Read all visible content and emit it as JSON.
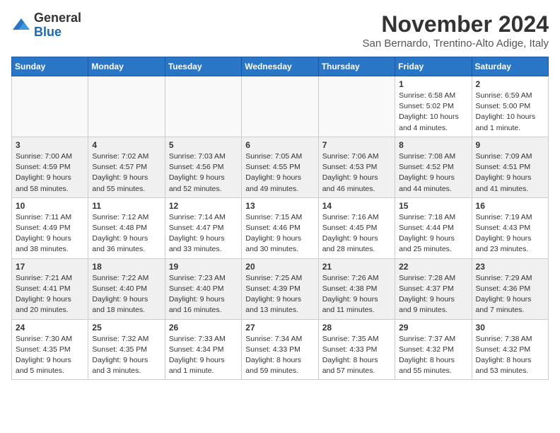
{
  "logo": {
    "general": "General",
    "blue": "Blue"
  },
  "title": "November 2024",
  "location": "San Bernardo, Trentino-Alto Adige, Italy",
  "days_of_week": [
    "Sunday",
    "Monday",
    "Tuesday",
    "Wednesday",
    "Thursday",
    "Friday",
    "Saturday"
  ],
  "weeks": [
    [
      {
        "day": "",
        "info": "",
        "empty": true
      },
      {
        "day": "",
        "info": "",
        "empty": true
      },
      {
        "day": "",
        "info": "",
        "empty": true
      },
      {
        "day": "",
        "info": "",
        "empty": true
      },
      {
        "day": "",
        "info": "",
        "empty": true
      },
      {
        "day": "1",
        "info": "Sunrise: 6:58 AM\nSunset: 5:02 PM\nDaylight: 10 hours\nand 4 minutes."
      },
      {
        "day": "2",
        "info": "Sunrise: 6:59 AM\nSunset: 5:00 PM\nDaylight: 10 hours\nand 1 minute."
      }
    ],
    [
      {
        "day": "3",
        "info": "Sunrise: 7:00 AM\nSunset: 4:59 PM\nDaylight: 9 hours\nand 58 minutes."
      },
      {
        "day": "4",
        "info": "Sunrise: 7:02 AM\nSunset: 4:57 PM\nDaylight: 9 hours\nand 55 minutes."
      },
      {
        "day": "5",
        "info": "Sunrise: 7:03 AM\nSunset: 4:56 PM\nDaylight: 9 hours\nand 52 minutes."
      },
      {
        "day": "6",
        "info": "Sunrise: 7:05 AM\nSunset: 4:55 PM\nDaylight: 9 hours\nand 49 minutes."
      },
      {
        "day": "7",
        "info": "Sunrise: 7:06 AM\nSunset: 4:53 PM\nDaylight: 9 hours\nand 46 minutes."
      },
      {
        "day": "8",
        "info": "Sunrise: 7:08 AM\nSunset: 4:52 PM\nDaylight: 9 hours\nand 44 minutes."
      },
      {
        "day": "9",
        "info": "Sunrise: 7:09 AM\nSunset: 4:51 PM\nDaylight: 9 hours\nand 41 minutes."
      }
    ],
    [
      {
        "day": "10",
        "info": "Sunrise: 7:11 AM\nSunset: 4:49 PM\nDaylight: 9 hours\nand 38 minutes."
      },
      {
        "day": "11",
        "info": "Sunrise: 7:12 AM\nSunset: 4:48 PM\nDaylight: 9 hours\nand 36 minutes."
      },
      {
        "day": "12",
        "info": "Sunrise: 7:14 AM\nSunset: 4:47 PM\nDaylight: 9 hours\nand 33 minutes."
      },
      {
        "day": "13",
        "info": "Sunrise: 7:15 AM\nSunset: 4:46 PM\nDaylight: 9 hours\nand 30 minutes."
      },
      {
        "day": "14",
        "info": "Sunrise: 7:16 AM\nSunset: 4:45 PM\nDaylight: 9 hours\nand 28 minutes."
      },
      {
        "day": "15",
        "info": "Sunrise: 7:18 AM\nSunset: 4:44 PM\nDaylight: 9 hours\nand 25 minutes."
      },
      {
        "day": "16",
        "info": "Sunrise: 7:19 AM\nSunset: 4:43 PM\nDaylight: 9 hours\nand 23 minutes."
      }
    ],
    [
      {
        "day": "17",
        "info": "Sunrise: 7:21 AM\nSunset: 4:41 PM\nDaylight: 9 hours\nand 20 minutes."
      },
      {
        "day": "18",
        "info": "Sunrise: 7:22 AM\nSunset: 4:40 PM\nDaylight: 9 hours\nand 18 minutes."
      },
      {
        "day": "19",
        "info": "Sunrise: 7:23 AM\nSunset: 4:40 PM\nDaylight: 9 hours\nand 16 minutes."
      },
      {
        "day": "20",
        "info": "Sunrise: 7:25 AM\nSunset: 4:39 PM\nDaylight: 9 hours\nand 13 minutes."
      },
      {
        "day": "21",
        "info": "Sunrise: 7:26 AM\nSunset: 4:38 PM\nDaylight: 9 hours\nand 11 minutes."
      },
      {
        "day": "22",
        "info": "Sunrise: 7:28 AM\nSunset: 4:37 PM\nDaylight: 9 hours\nand 9 minutes."
      },
      {
        "day": "23",
        "info": "Sunrise: 7:29 AM\nSunset: 4:36 PM\nDaylight: 9 hours\nand 7 minutes."
      }
    ],
    [
      {
        "day": "24",
        "info": "Sunrise: 7:30 AM\nSunset: 4:35 PM\nDaylight: 9 hours\nand 5 minutes."
      },
      {
        "day": "25",
        "info": "Sunrise: 7:32 AM\nSunset: 4:35 PM\nDaylight: 9 hours\nand 3 minutes."
      },
      {
        "day": "26",
        "info": "Sunrise: 7:33 AM\nSunset: 4:34 PM\nDaylight: 9 hours\nand 1 minute."
      },
      {
        "day": "27",
        "info": "Sunrise: 7:34 AM\nSunset: 4:33 PM\nDaylight: 8 hours\nand 59 minutes."
      },
      {
        "day": "28",
        "info": "Sunrise: 7:35 AM\nSunset: 4:33 PM\nDaylight: 8 hours\nand 57 minutes."
      },
      {
        "day": "29",
        "info": "Sunrise: 7:37 AM\nSunset: 4:32 PM\nDaylight: 8 hours\nand 55 minutes."
      },
      {
        "day": "30",
        "info": "Sunrise: 7:38 AM\nSunset: 4:32 PM\nDaylight: 8 hours\nand 53 minutes."
      }
    ]
  ]
}
